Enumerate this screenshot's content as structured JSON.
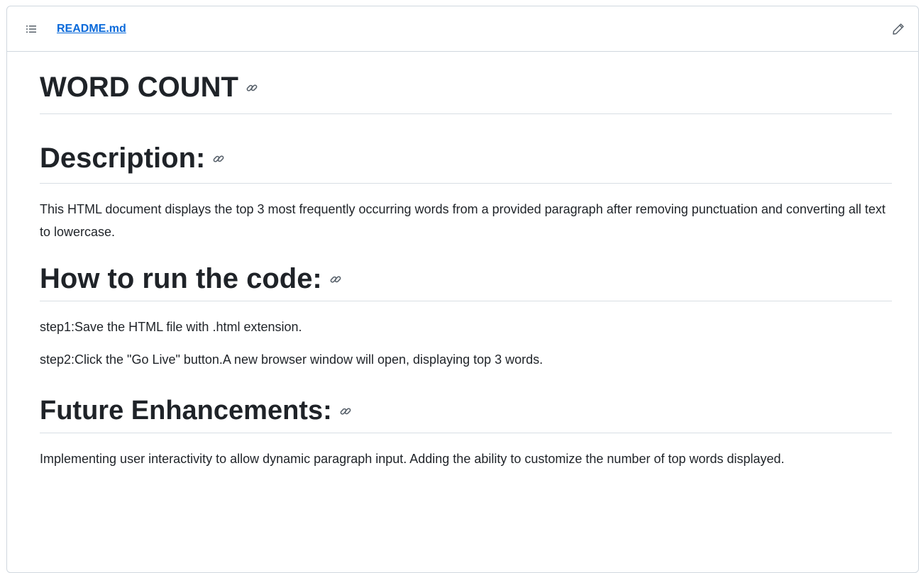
{
  "header": {
    "file_name": "README.md",
    "toc_icon": "list-unordered-icon",
    "edit_icon": "pencil-icon"
  },
  "readme": {
    "title": "WORD COUNT",
    "sections": {
      "description": {
        "heading": "Description:",
        "text": "This HTML document displays the top 3 most frequently occurring words from a provided paragraph after removing punctuation and converting all text to lowercase."
      },
      "how_to_run": {
        "heading": "How to run the code:",
        "step1": "step1:Save the HTML file with .html extension.",
        "step2": "step2:Click the \"Go Live\" button.A new browser window will open, displaying top 3 words."
      },
      "future": {
        "heading": "Future Enhancements:",
        "text": "Implementing user interactivity to allow dynamic paragraph input. Adding the ability to customize the number of top words displayed."
      }
    },
    "anchor_icon": "link-icon"
  },
  "colors": {
    "link": "#0969da",
    "text": "#1f2328",
    "muted": "#57606a",
    "border": "#d0d7de"
  }
}
